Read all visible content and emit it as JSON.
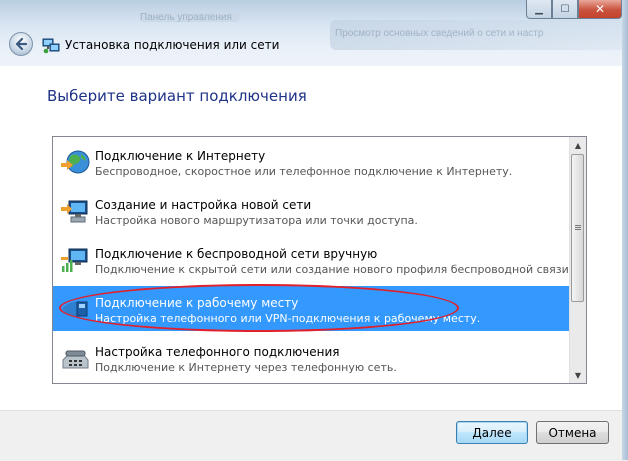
{
  "window": {
    "title": "Установка подключения или сети",
    "background_text_1": "Панель управления",
    "background_text_2": "Просмотр основных сведений о сети и настр"
  },
  "caption_buttons": {
    "minimize_icon": "minimize-icon",
    "maximize_icon": "maximize-icon",
    "close_icon": "close-icon"
  },
  "heading": "Выберите вариант подключения",
  "options": [
    {
      "title": "Подключение к Интернету",
      "description": "Беспроводное, скоростное или телефонное подключение к Интернету.",
      "icon": "globe-network-icon",
      "selected": false
    },
    {
      "title": "Создание и настройка новой сети",
      "description": "Настройка нового маршрутизатора или точки доступа.",
      "icon": "new-network-icon",
      "selected": false
    },
    {
      "title": "Подключение к беспроводной сети вручную",
      "description": "Подключение к скрытой сети или создание нового профиля беспроводной связи.",
      "icon": "wireless-network-icon",
      "selected": false
    },
    {
      "title": "Подключение к рабочему месту",
      "description": "Настройка телефонного или VPN-подключения к рабочему месту.",
      "icon": "workplace-vpn-icon",
      "selected": true
    },
    {
      "title": "Настройка телефонного подключения",
      "description": "Подключение к Интернету через телефонную сеть.",
      "icon": "dialup-phone-icon",
      "selected": false
    }
  ],
  "buttons": {
    "next": "Далее",
    "cancel": "Отмена"
  },
  "colors": {
    "heading": "#1e3287",
    "selection": "#3399ff",
    "annotation": "#e0202a"
  }
}
